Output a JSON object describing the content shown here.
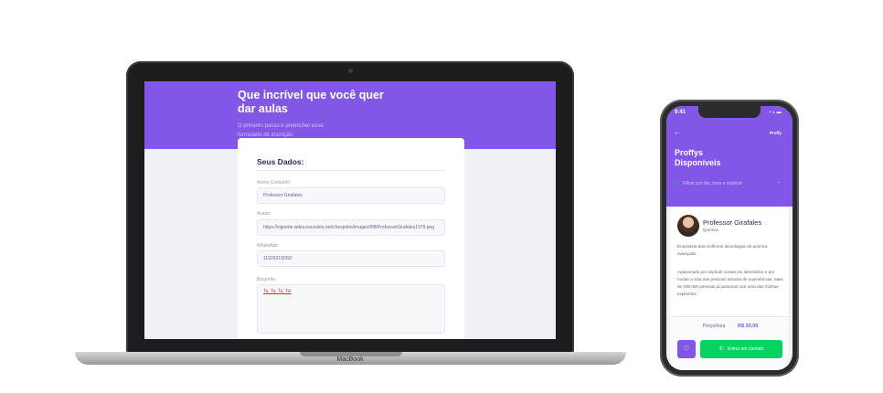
{
  "laptop": {
    "brand": "MacBook",
    "form": {
      "title": "Que incrível que você quer dar aulas",
      "subtitle": "O primeiro passo é preencher esse formulário de inscrição",
      "section_title": "Seus Dados:",
      "fields": {
        "name_label": "Nome Completo",
        "name_value": "Professor Girafales",
        "avatar_label": "Avatar",
        "avatar_value": "https://vignette.wikia.nocookie.net/chespirito/images/f/f8/ProfessorGirafales1979.png",
        "whatsapp_label": "WhatsApp",
        "whatsapp_value": "11926319I392",
        "bio_label": "Biografia",
        "bio_value": "Ta, Ta, Ta, Ta!"
      }
    }
  },
  "phone": {
    "time": "9:41",
    "status": "▪ ◒ ▬",
    "back": "←",
    "logo": "Proffy",
    "title": "Proffys Disponíveis",
    "filter_icon": "filter-icon",
    "filter_glyph": "▽",
    "filter_text": "Filtrar por dia, hora e matéria",
    "filter_chevron": "⌄",
    "card": {
      "name": "Professor Girafales",
      "subject": "Química",
      "bio_1": "Entusiasta das melhores tecnologias de química avançada.",
      "bio_2": "Apaixonado por explodir coisas em laboratório e por mudar a vida das pessoas através de experiências. Mais de 200.000 pessoas já passaram por uma das minhas explosões.",
      "price_label": "Preço/hora",
      "price_value": "R$ 20,00",
      "fav_glyph": "♡",
      "wa_glyph": "✆",
      "contact_label": "Entrar em contato"
    }
  },
  "colors": {
    "primary": "#8257e5",
    "secondary": "#04d361",
    "background": "#f0f0f7"
  }
}
